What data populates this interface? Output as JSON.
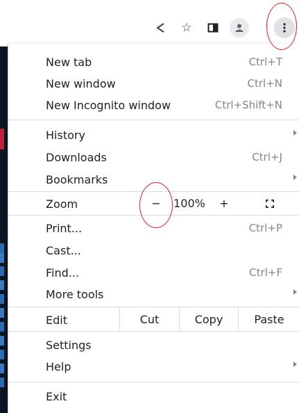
{
  "toolbar": {
    "icons": [
      "share-icon",
      "bookmark-star-icon",
      "side-panel-icon",
      "profile-avatar-icon",
      "kebab-menu-icon"
    ]
  },
  "menu": {
    "new_tab": {
      "label": "New tab",
      "shortcut": "Ctrl+T"
    },
    "new_window": {
      "label": "New window",
      "shortcut": "Ctrl+N"
    },
    "new_incognito": {
      "label": "New Incognito window",
      "shortcut": "Ctrl+Shift+N"
    },
    "history": {
      "label": "History"
    },
    "downloads": {
      "label": "Downloads",
      "shortcut": "Ctrl+J"
    },
    "bookmarks": {
      "label": "Bookmarks"
    },
    "zoom": {
      "label": "Zoom",
      "minus": "−",
      "level": "100%",
      "plus": "+"
    },
    "print": {
      "label": "Print...",
      "shortcut": "Ctrl+P"
    },
    "cast": {
      "label": "Cast..."
    },
    "find": {
      "label": "Find...",
      "shortcut": "Ctrl+F"
    },
    "more_tools": {
      "label": "More tools"
    },
    "edit": {
      "label": "Edit",
      "cut": "Cut",
      "copy": "Copy",
      "paste": "Paste"
    },
    "settings": {
      "label": "Settings"
    },
    "help": {
      "label": "Help"
    },
    "exit": {
      "label": "Exit"
    }
  },
  "colors": {
    "annotation_ring": "#e02020",
    "separator": "#dadce0",
    "shortcut_text": "#80868b"
  }
}
